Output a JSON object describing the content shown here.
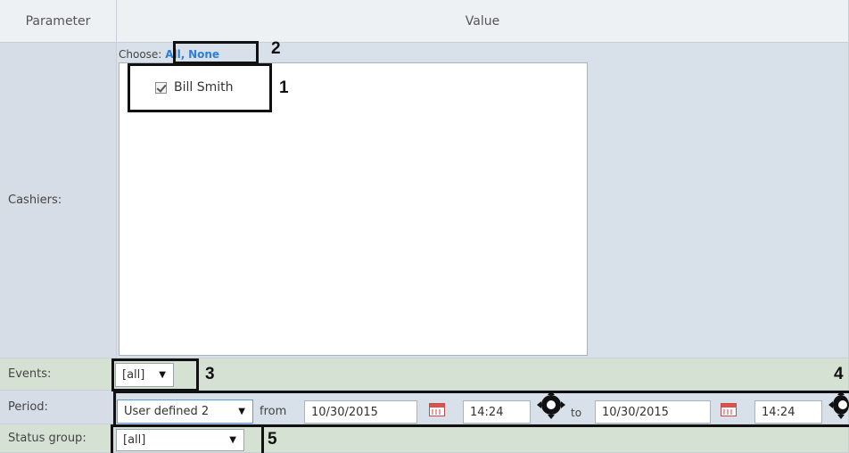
{
  "table": {
    "header_parameter": "Parameter",
    "header_value": "Value"
  },
  "cashiers": {
    "label": "Cashiers:",
    "choose_prefix": "Choose:",
    "choose_all": "All",
    "choose_sep": ",",
    "choose_none": "None",
    "items": [
      {
        "label": "Bill Smith",
        "checked": true
      }
    ]
  },
  "events": {
    "label": "Events:",
    "value": "[all]"
  },
  "period": {
    "label": "Period:",
    "type_value": "User defined 2",
    "from_label": "from",
    "from_date": "10/30/2015",
    "from_time": "14:24",
    "to_label": "to",
    "to_date": "10/30/2015",
    "to_time": "14:24"
  },
  "status_group": {
    "label": "Status group:",
    "value": "[all]"
  },
  "annotations": {
    "n1": "1",
    "n2": "2",
    "n3": "3",
    "n4": "4",
    "n5": "5"
  },
  "icons": {
    "calendar": "calendar-icon",
    "move": "move-arrows-icon",
    "dropdown": "triangle-down"
  },
  "colors": {
    "link": "#2e7fd6",
    "label_bg": "#d6dde6",
    "value_bg": "#d8e0ea",
    "green_row_bg": "#d5e2d3",
    "header_bg": "#eef1f4"
  }
}
